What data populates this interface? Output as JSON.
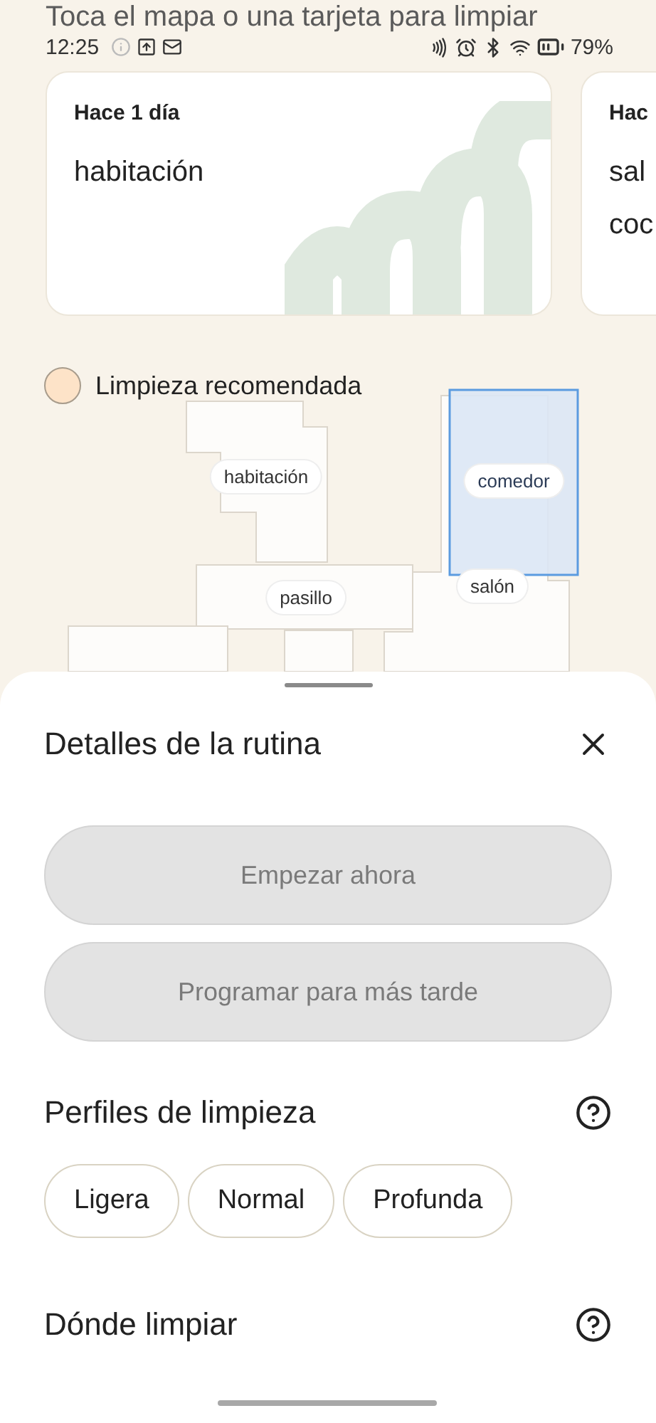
{
  "hint": "Toca el mapa o una tarjeta para limpiar",
  "status_bar": {
    "time": "12:25",
    "battery": "79%"
  },
  "cards": [
    {
      "when": "Hace 1 día",
      "rooms": [
        "habitación"
      ]
    },
    {
      "when": "Hac",
      "rooms": [
        "sal",
        "coc"
      ]
    }
  ],
  "legend": {
    "label": "Limpieza recomendada",
    "color": "#fde3c8"
  },
  "map": {
    "rooms": [
      {
        "label": "habitación",
        "selected": false
      },
      {
        "label": "comedor",
        "selected": true
      },
      {
        "label": "pasillo",
        "selected": false
      },
      {
        "label": "salón",
        "selected": false
      }
    ]
  },
  "sheet": {
    "title": "Detalles de la rutina",
    "actions": [
      {
        "label": "Empezar ahora",
        "disabled": true
      },
      {
        "label": "Programar para más tarde",
        "disabled": true
      }
    ],
    "profiles": {
      "title": "Perfiles de limpieza",
      "options": [
        {
          "label": "Ligera",
          "selected": false
        },
        {
          "label": "Normal",
          "selected": false
        },
        {
          "label": "Profunda",
          "selected": false
        }
      ]
    },
    "where": {
      "title": "Dónde limpiar"
    }
  }
}
